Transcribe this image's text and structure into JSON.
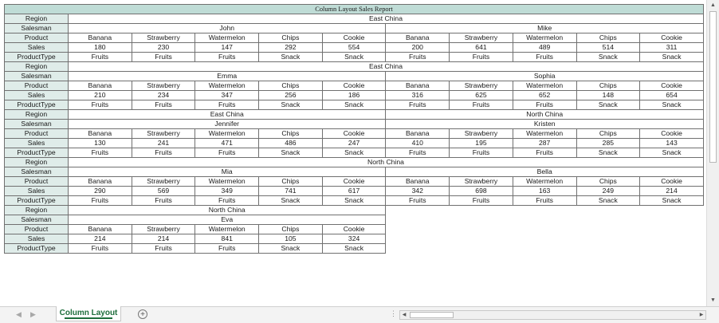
{
  "report_title": "Column Layout Sales Report",
  "row_labels": {
    "region": "Region",
    "salesman": "Salesman",
    "product": "Product",
    "sales": "Sales",
    "product_type": "ProductType"
  },
  "blocks": [
    {
      "region_merged": "East China",
      "salesmen": [
        {
          "name": "John",
          "products": [
            "Banana",
            "Strawberry",
            "Watermelon",
            "Chips",
            "Cookie"
          ],
          "sales": [
            "180",
            "230",
            "147",
            "292",
            "554"
          ],
          "types": [
            "Fruits",
            "Fruits",
            "Fruits",
            "Snack",
            "Snack"
          ]
        },
        {
          "name": "Mike",
          "products": [
            "Banana",
            "Strawberry",
            "Watermelon",
            "Chips",
            "Cookie"
          ],
          "sales": [
            "200",
            "641",
            "489",
            "514",
            "311"
          ],
          "types": [
            "Fruits",
            "Fruits",
            "Fruits",
            "Snack",
            "Snack"
          ]
        }
      ]
    },
    {
      "region_merged": "East China",
      "salesmen": [
        {
          "name": "Emma",
          "products": [
            "Banana",
            "Strawberry",
            "Watermelon",
            "Chips",
            "Cookie"
          ],
          "sales": [
            "210",
            "234",
            "347",
            "256",
            "186"
          ],
          "types": [
            "Fruits",
            "Fruits",
            "Fruits",
            "Snack",
            "Snack"
          ]
        },
        {
          "name": "Sophia",
          "products": [
            "Banana",
            "Strawberry",
            "Watermelon",
            "Chips",
            "Cookie"
          ],
          "sales": [
            "316",
            "625",
            "652",
            "148",
            "654"
          ],
          "types": [
            "Fruits",
            "Fruits",
            "Fruits",
            "Snack",
            "Snack"
          ]
        }
      ]
    },
    {
      "region_split": [
        "East China",
        "North China"
      ],
      "salesmen": [
        {
          "name": "Jennifer",
          "products": [
            "Banana",
            "Strawberry",
            "Watermelon",
            "Chips",
            "Cookie"
          ],
          "sales": [
            "130",
            "241",
            "471",
            "486",
            "247"
          ],
          "types": [
            "Fruits",
            "Fruits",
            "Fruits",
            "Snack",
            "Snack"
          ]
        },
        {
          "name": "Kristen",
          "products": [
            "Banana",
            "Strawberry",
            "Watermelon",
            "Chips",
            "Cookie"
          ],
          "sales": [
            "410",
            "195",
            "287",
            "285",
            "143"
          ],
          "types": [
            "Fruits",
            "Fruits",
            "Fruits",
            "Snack",
            "Snack"
          ]
        }
      ]
    },
    {
      "region_merged": "North China",
      "salesmen": [
        {
          "name": "Mia",
          "products": [
            "Banana",
            "Strawberry",
            "Watermelon",
            "Chips",
            "Cookie"
          ],
          "sales": [
            "290",
            "569",
            "349",
            "741",
            "617"
          ],
          "types": [
            "Fruits",
            "Fruits",
            "Fruits",
            "Snack",
            "Snack"
          ]
        },
        {
          "name": "Bella",
          "products": [
            "Banana",
            "Strawberry",
            "Watermelon",
            "Chips",
            "Cookie"
          ],
          "sales": [
            "342",
            "698",
            "163",
            "249",
            "214"
          ],
          "types": [
            "Fruits",
            "Fruits",
            "Fruits",
            "Snack",
            "Snack"
          ]
        }
      ]
    },
    {
      "region_split": [
        "North China"
      ],
      "salesmen": [
        {
          "name": "Eva",
          "products": [
            "Banana",
            "Strawberry",
            "Watermelon",
            "Chips",
            "Cookie"
          ],
          "sales": [
            "214",
            "214",
            "841",
            "105",
            "324"
          ],
          "types": [
            "Fruits",
            "Fruits",
            "Fruits",
            "Snack",
            "Snack"
          ]
        }
      ]
    }
  ],
  "sheet_tab": "Column Layout",
  "add_sheet_symbol": "+",
  "nav_prev_symbol": "◀",
  "nav_next_symbol": "▶",
  "tab_split_symbol": "⋮",
  "scroll_up_symbol": "▲",
  "scroll_down_symbol": "▼",
  "scroll_left_symbol": "◀",
  "scroll_right_symbol": "▶",
  "colors": {
    "title_fill": "#bfdcd6",
    "label_fill": "#dfece9",
    "grid_line": "#707070",
    "tab_text": "#1e6e3c"
  }
}
